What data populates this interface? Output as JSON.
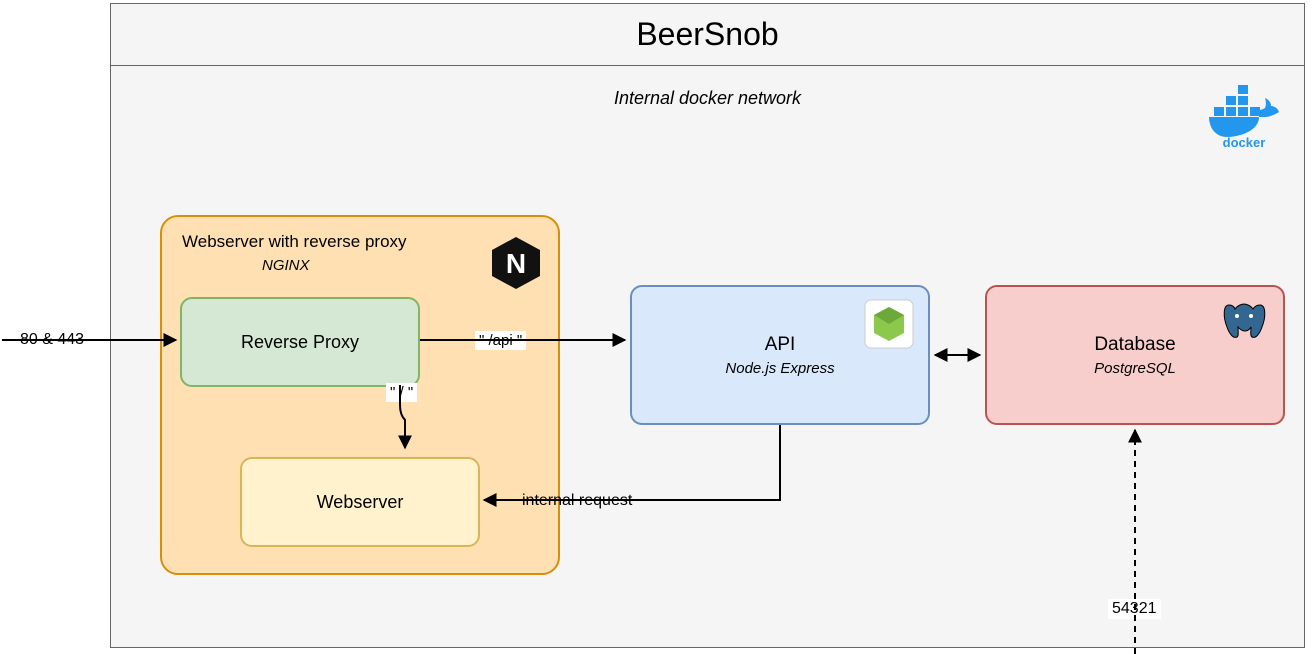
{
  "container": {
    "title": "BeerSnob",
    "network_label": "Internal docker network"
  },
  "nginx": {
    "title": "Webserver with reverse proxy",
    "subtitle": "NGINX",
    "reverse_proxy_label": "Reverse Proxy",
    "webserver_label": "Webserver"
  },
  "api": {
    "title": "API",
    "subtitle": "Node.js Express"
  },
  "database": {
    "title": "Database",
    "subtitle": "PostgreSQL"
  },
  "edges": {
    "ingress_ports": "80 & 443",
    "route_api": "\" /api \"",
    "route_root": "\" / \"",
    "internal_request": "internal request",
    "db_port": "54321"
  },
  "logos": {
    "docker": "docker",
    "nginx": "N",
    "node": "node-icon",
    "postgres": "postgres-icon"
  }
}
